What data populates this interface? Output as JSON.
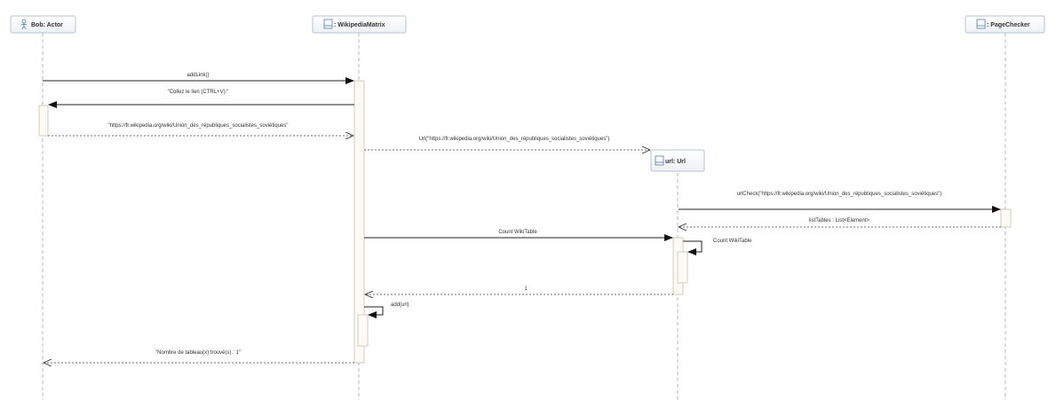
{
  "lifelines": {
    "actor": {
      "label": "Bob: Actor",
      "icon": "actor-icon"
    },
    "matrix": {
      "label": ": WikipediaMatrix",
      "icon": "class-icon"
    },
    "checker": {
      "label": ": PageChecker",
      "icon": "class-icon"
    },
    "url": {
      "label": "url: Url",
      "icon": "class-icon"
    }
  },
  "messages": {
    "m1": "addLink()",
    "m2": "\"Collez le lien (CTRL+V):\"",
    "m3": "\"https://fr.wikipedia.org/wiki/Union_des_républiques_socialistes_soviétiques\"",
    "m4": "Url(\"https://fr.wikipedia.org/wiki/Union_des_républiques_socialistes_soviétiques\")",
    "m5": "urlCheck(\"https://fr.wikipedia.org/wiki/Union_des_républiques_socialistes_soviétiques\")",
    "m6": "listTables : List<Element>",
    "m7": "Count WikiTable",
    "m8": "Count WikiTable",
    "m9": "1",
    "m10": "add(url)",
    "m11": "\"Nombre de tableau(x) trouvé(s) : 1\""
  }
}
